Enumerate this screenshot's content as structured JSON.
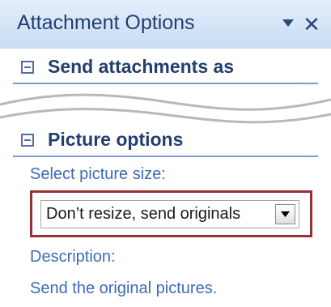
{
  "pane": {
    "title": "Attachment Options",
    "dropdown_icon": "triangle-down",
    "close_icon": "x"
  },
  "sections": [
    {
      "label": "Send attachments as",
      "expanded": true
    },
    {
      "label": "Picture options",
      "expanded": true
    }
  ],
  "picture_options": {
    "size_label": "Select picture size:",
    "size_select": {
      "selected": "Don’t resize, send originals"
    },
    "description_label": "Description:",
    "description_text": "Send the original pictures."
  },
  "colors": {
    "title_text": "#1f3f70",
    "link_blue": "#3d6bb3",
    "highlight_border": "#9b2d35"
  }
}
